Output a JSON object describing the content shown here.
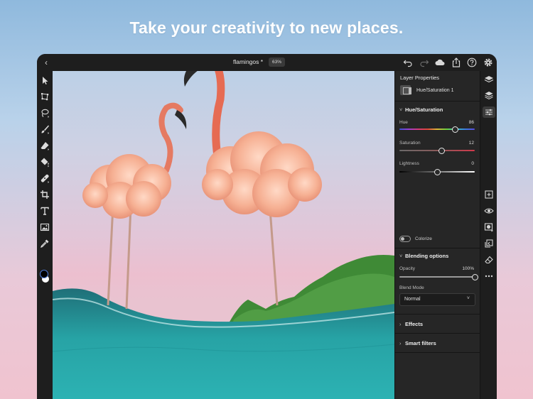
{
  "headline": "Take your creativity to new places.",
  "topbar": {
    "document_title": "flamingos",
    "modified_marker": "*",
    "zoom": "63%",
    "icons": [
      "chevron-left-icon",
      "undo-icon",
      "redo-icon",
      "cloud-icon",
      "share-icon",
      "help-icon",
      "gear-icon"
    ]
  },
  "toolbar": {
    "tools": [
      "select-arrow-icon",
      "transform-icon",
      "lasso-icon",
      "brush-icon",
      "eraser-icon",
      "fill-icon",
      "healing-icon",
      "crop-icon",
      "type-icon",
      "image-icon",
      "eyedropper-icon"
    ],
    "foreground_color": "#000000",
    "background_color": "#ffffff"
  },
  "layer_properties": {
    "title": "Layer Properties",
    "layer_name": "Hue/Saturation 1"
  },
  "hue_saturation": {
    "heading": "Hue/Saturation",
    "hue": {
      "label": "Hue",
      "value": 86,
      "min": -180,
      "max": 180
    },
    "saturation": {
      "label": "Saturation",
      "value": 12,
      "min": -100,
      "max": 100
    },
    "lightness": {
      "label": "Lightness",
      "value": 0,
      "min": -100,
      "max": 100
    },
    "colorize_label": "Colorize",
    "colorize_on": false
  },
  "blending_options": {
    "heading": "Blending options",
    "opacity": {
      "label": "Opacity",
      "display": "100%",
      "value": 100,
      "min": 0,
      "max": 100
    },
    "blend_mode_label": "Blend Mode",
    "blend_mode_value": "Normal"
  },
  "effects": {
    "heading": "Effects"
  },
  "smart_filters": {
    "heading": "Smart filters"
  },
  "rail": {
    "icons": [
      "layers-icon",
      "layer-stack-icon",
      "properties-sliders-icon",
      "add-layer-icon",
      "visibility-icon",
      "mask-icon",
      "clip-icon",
      "eraser-layer-icon",
      "more-icon"
    ],
    "active": "properties-sliders-icon"
  },
  "colors": {
    "accent": "#4e7bd9",
    "panel_bg": "#262626",
    "app_bg": "#1e1e1e"
  }
}
